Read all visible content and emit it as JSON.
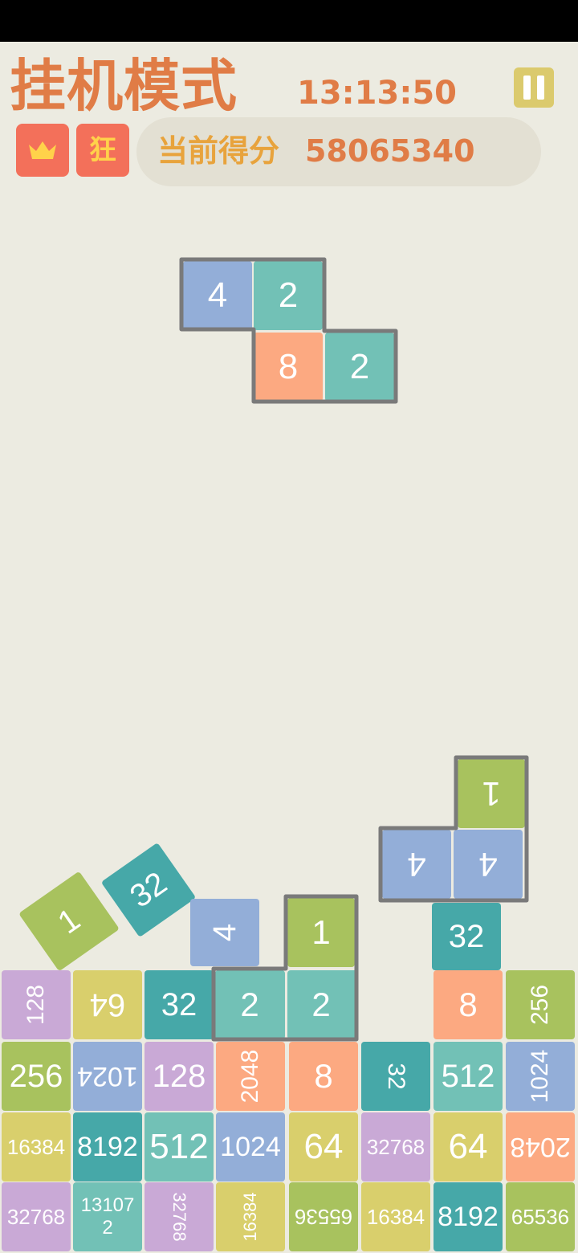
{
  "header": {
    "title": "挂机模式",
    "time": "13:13:50",
    "crown_badge": "crown-icon",
    "mode_badge": "狂",
    "score_label": "当前得分",
    "score_value": "58065340"
  },
  "colors": {
    "background": "#ecebe1",
    "accent": "#e07c46",
    "badge": "#f3705a",
    "pause": "#dbca6d"
  },
  "falling_piece": {
    "tiles": [
      "4",
      "2",
      "8",
      "2"
    ]
  },
  "loose_tiles": [
    "1",
    "32",
    "4",
    "1",
    "2",
    "2",
    "1",
    "4",
    "4",
    "32"
  ],
  "grid": {
    "rows": [
      [
        "128",
        "64",
        "32",
        "2",
        "2",
        "",
        "8",
        "256"
      ],
      [
        "256",
        "1024",
        "128",
        "2048",
        "8",
        "32",
        "512",
        "1024"
      ],
      [
        "16384",
        "8192",
        "512",
        "1024",
        "64",
        "32768",
        "64",
        "2048"
      ],
      [
        "32768",
        "131072",
        "32768",
        "16384",
        "65536",
        "16384",
        "8192",
        "65536"
      ]
    ]
  }
}
